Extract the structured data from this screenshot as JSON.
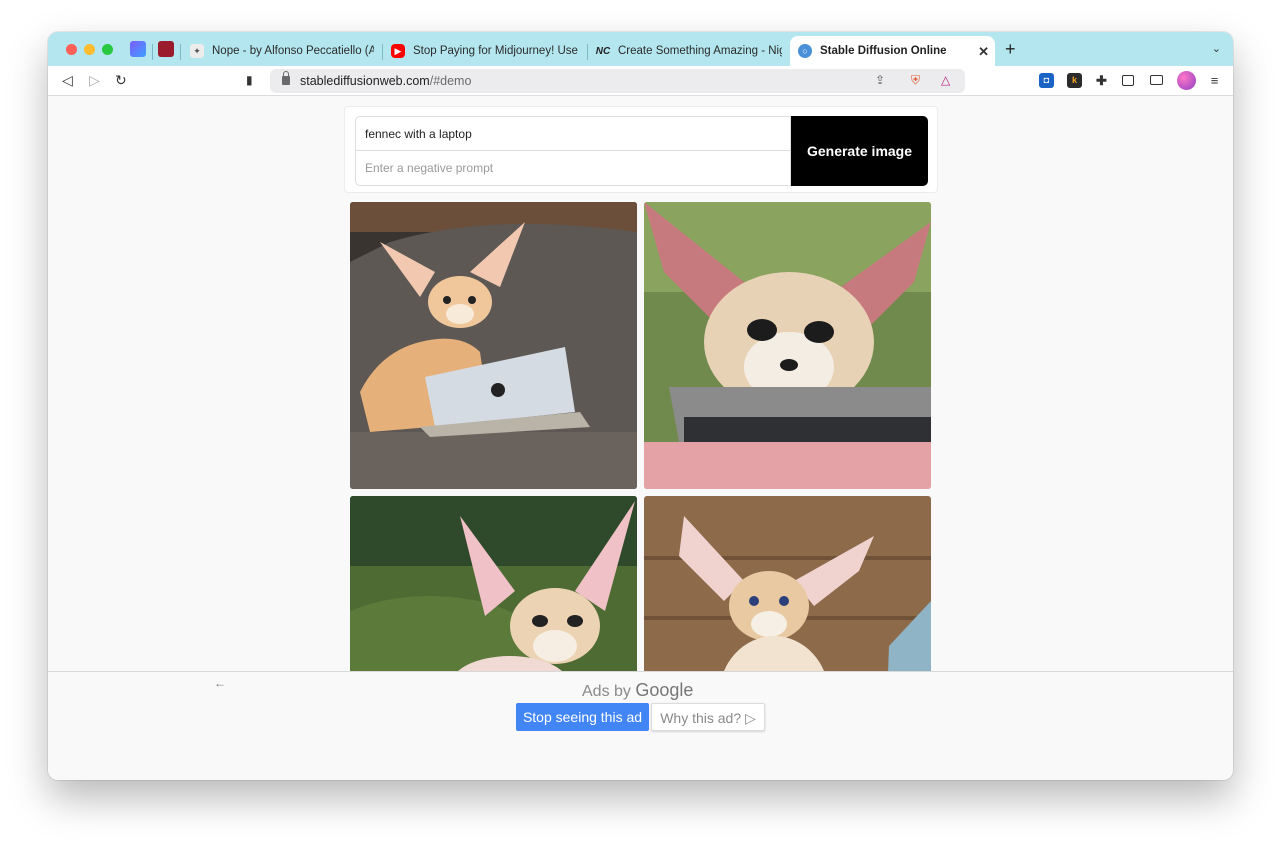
{
  "browser": {
    "tabs": [
      {
        "title": "Nope - by Alfonso Peccatiello (Alf)",
        "favicon": "sparkle-icon",
        "color": "#e8e8e8"
      },
      {
        "title": "Stop Paying for Midjourney! Use the",
        "favicon": "youtube-icon",
        "color": "#ff0000"
      },
      {
        "title": "Create Something Amazing - Night",
        "favicon": "nightcafe-icon",
        "color": "#222222"
      },
      {
        "title": "Stable Diffusion Online",
        "favicon": "stable-diffusion-icon",
        "color": "#4a90d9"
      }
    ],
    "address": {
      "domain": "stablediffusionweb.com",
      "path": "/#demo"
    },
    "accent": "#b3e6ee"
  },
  "prompt": {
    "value": "fennec with a laptop",
    "negative_placeholder": "Enter a negative prompt",
    "button_label": "Generate image"
  },
  "results": {
    "images": [
      {
        "alt": "fennec fox with a silver laptop on a gray couch"
      },
      {
        "alt": "close-up fennec fox behind a laptop keyboard"
      },
      {
        "alt": "fennec fox on green moss with a laptop"
      },
      {
        "alt": "fennec fox with blue eyes beside a laptop"
      }
    ]
  },
  "ad": {
    "ads_by_prefix": "Ads by",
    "ads_by_brand": "Google",
    "stop_label": "Stop seeing this ad",
    "why_label": "Why this ad? ▷",
    "stop_color": "#4286f5"
  }
}
